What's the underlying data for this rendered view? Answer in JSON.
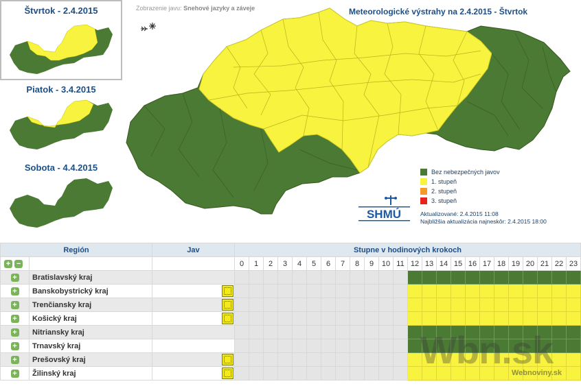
{
  "days": [
    {
      "label": "Štvrtok - 2.4.2015",
      "selected": true
    },
    {
      "label": "Piatok - 3.4.2015",
      "selected": false
    },
    {
      "label": "Sobota - 4.4.2015",
      "selected": false
    }
  ],
  "header": {
    "display_prefix": "Zobrazenie javu:",
    "display_value": "Snehové jazyky a záveje",
    "title": "Meteorologické výstrahy na 2.4.2015 - Štvrtok"
  },
  "legend": [
    {
      "label": "Bez nebezpečných javov",
      "color": "#4a7a33"
    },
    {
      "label": "1. stupeň",
      "color": "#f7f33e"
    },
    {
      "label": "2. stupeň",
      "color": "#f39a2b"
    },
    {
      "label": "3. stupeň",
      "color": "#e8231d"
    }
  ],
  "updated": {
    "line1": "Aktualizované: 2.4.2015 11:08",
    "line2": "Najbližšia aktualizácia najneskôr: 2.4.2015 18:00"
  },
  "logo_text": "SHMÚ",
  "colors": {
    "green": "#4a7a33",
    "yellow": "#f7f33e",
    "map_border": "#3a5f27"
  },
  "table": {
    "col_region": "Región",
    "col_phenomenon": "Jav",
    "col_hours": "Stupne v hodinových krokoch",
    "hours": [
      "0",
      "1",
      "2",
      "3",
      "4",
      "5",
      "6",
      "7",
      "8",
      "9",
      "10",
      "11",
      "12",
      "13",
      "14",
      "15",
      "16",
      "17",
      "18",
      "19",
      "20",
      "21",
      "22",
      "23"
    ],
    "rows": [
      {
        "name": "Bratislavský kraj",
        "icon": false,
        "level": "green"
      },
      {
        "name": "Banskobystrický kraj",
        "icon": true,
        "level": "yellow"
      },
      {
        "name": "Trenčiansky kraj",
        "icon": true,
        "level": "yellow"
      },
      {
        "name": "Košický kraj",
        "icon": true,
        "level": "yellow"
      },
      {
        "name": "Nitriansky kraj",
        "icon": false,
        "level": "green"
      },
      {
        "name": "Trnavský kraj",
        "icon": false,
        "level": "green"
      },
      {
        "name": "Prešovský kraj",
        "icon": true,
        "level": "yellow"
      },
      {
        "name": "Žilinský kraj",
        "icon": true,
        "level": "yellow"
      }
    ],
    "first_active_hour": 12
  },
  "watermark": {
    "main": "Wbn.sk",
    "sub": "Webnoviny.sk"
  }
}
